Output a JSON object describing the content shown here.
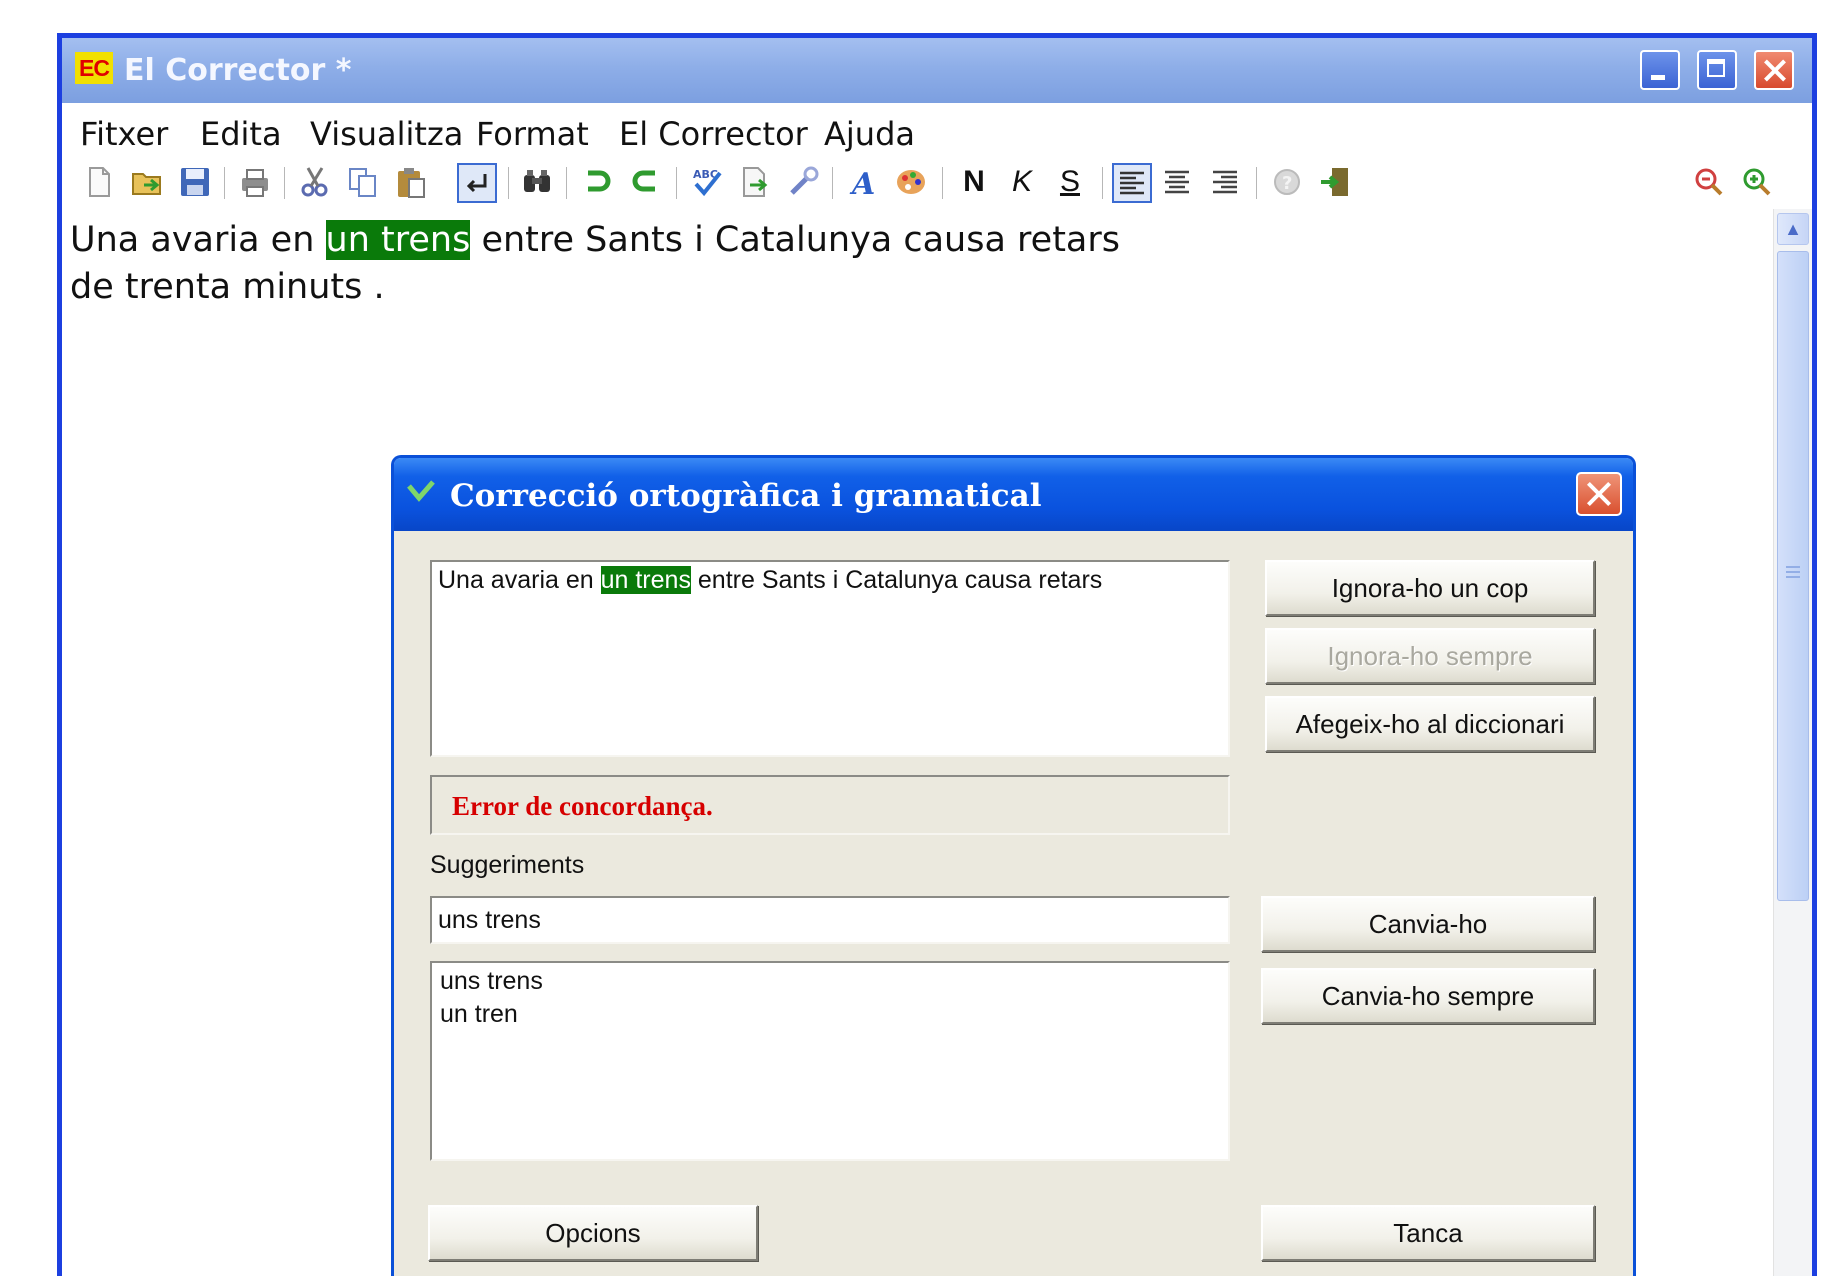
{
  "window": {
    "icon_text": "EC",
    "title": "El Corrector *"
  },
  "menu": [
    "Fitxer",
    "Edita",
    "Visualitza",
    "Format",
    "El Corrector",
    "Ajuda"
  ],
  "toolbar": {
    "bold": "N",
    "italic": "K",
    "strike": "S"
  },
  "document": {
    "line1_before": "Una avaria en ",
    "line1_highlight": "un trens",
    "line1_after": " entre Sants i Catalunya causa retars",
    "line2": "de trenta minuts ."
  },
  "dialog": {
    "title": "Correcció ortogràfica i gramatical",
    "context_before": "Una avaria en ",
    "context_highlight": "un trens",
    "context_after": " entre Sants i Catalunya causa retars",
    "error_message": "Error de concordança.",
    "suggestions_label": "Suggeriments",
    "suggestion_value": "uns trens",
    "suggestions": [
      "uns trens",
      "un tren"
    ],
    "buttons": {
      "ignore_once": "Ignora-ho un cop",
      "ignore_always": "Ignora-ho sempre",
      "add_dictionary": "Afegeix-ho al diccionari",
      "change": "Canvia-ho",
      "change_always": "Canvia-ho sempre",
      "options": "Opcions",
      "close": "Tanca"
    }
  },
  "colors": {
    "highlight": "#0a7a0a",
    "error": "#d60000",
    "dialog_titlebar": "#0a52de"
  }
}
